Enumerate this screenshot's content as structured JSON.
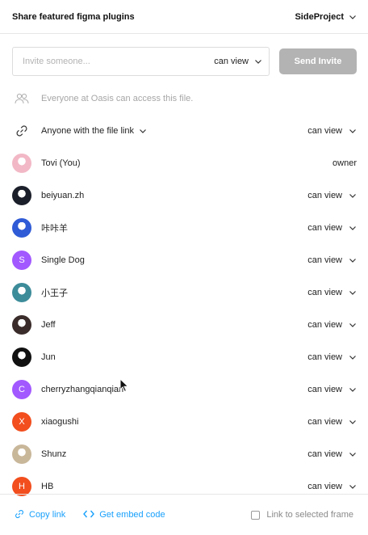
{
  "header": {
    "title": "Share featured figma plugins",
    "project": "SideProject",
    "chevron_icon": "chevron-down-icon"
  },
  "invite": {
    "placeholder": "Invite someone...",
    "permission": "can view",
    "send_label": "Send Invite"
  },
  "team_access": {
    "icon": "people-icon",
    "text": "Everyone at Oasis can access this file."
  },
  "link_access": {
    "icon": "link-icon",
    "label": "Anyone with the file link",
    "permission": "can view"
  },
  "members": [
    {
      "name": "Tovi (You)",
      "role": "owner",
      "avatar_type": "image",
      "avatar_color": "#f2b8c6",
      "initial": "",
      "has_dropdown": false
    },
    {
      "name": "beiyuan.zh",
      "role": "can view",
      "avatar_type": "image",
      "avatar_color": "#1b1f2a",
      "initial": "",
      "has_dropdown": true
    },
    {
      "name": "咔咔羊",
      "role": "can view",
      "avatar_type": "image",
      "avatar_color": "#2f5bd6",
      "initial": "",
      "has_dropdown": true
    },
    {
      "name": "Single Dog",
      "role": "can view",
      "avatar_type": "initial",
      "avatar_color": "#a259ff",
      "initial": "S",
      "has_dropdown": true
    },
    {
      "name": "小王子",
      "role": "can view",
      "avatar_type": "image",
      "avatar_color": "#3d8c9a",
      "initial": "",
      "has_dropdown": true
    },
    {
      "name": "Jeff",
      "role": "can view",
      "avatar_type": "image",
      "avatar_color": "#3a2c2a",
      "initial": "",
      "has_dropdown": true
    },
    {
      "name": "Jun",
      "role": "can view",
      "avatar_type": "image",
      "avatar_color": "#111111",
      "initial": "",
      "has_dropdown": true
    },
    {
      "name": "cherryzhangqianqian",
      "role": "can view",
      "avatar_type": "initial",
      "avatar_color": "#a259ff",
      "initial": "C",
      "has_dropdown": true
    },
    {
      "name": "xiaogushi",
      "role": "can view",
      "avatar_type": "initial",
      "avatar_color": "#f24e1e",
      "initial": "X",
      "has_dropdown": true
    },
    {
      "name": "Shunz",
      "role": "can view",
      "avatar_type": "image",
      "avatar_color": "#c9b79a",
      "initial": "",
      "has_dropdown": true
    },
    {
      "name": "HB",
      "role": "can view",
      "avatar_type": "initial",
      "avatar_color": "#f24e1e",
      "initial": "H",
      "has_dropdown": true
    }
  ],
  "footer": {
    "copy_link": "Copy link",
    "copy_icon": "link-icon",
    "embed": "Get embed code",
    "embed_icon": "code-icon",
    "frame_checkbox": "Link to selected frame",
    "link_color": "#18a0fb"
  },
  "colors": {
    "send_disabled": "#b3b3b3",
    "accent": "#18a0fb"
  }
}
